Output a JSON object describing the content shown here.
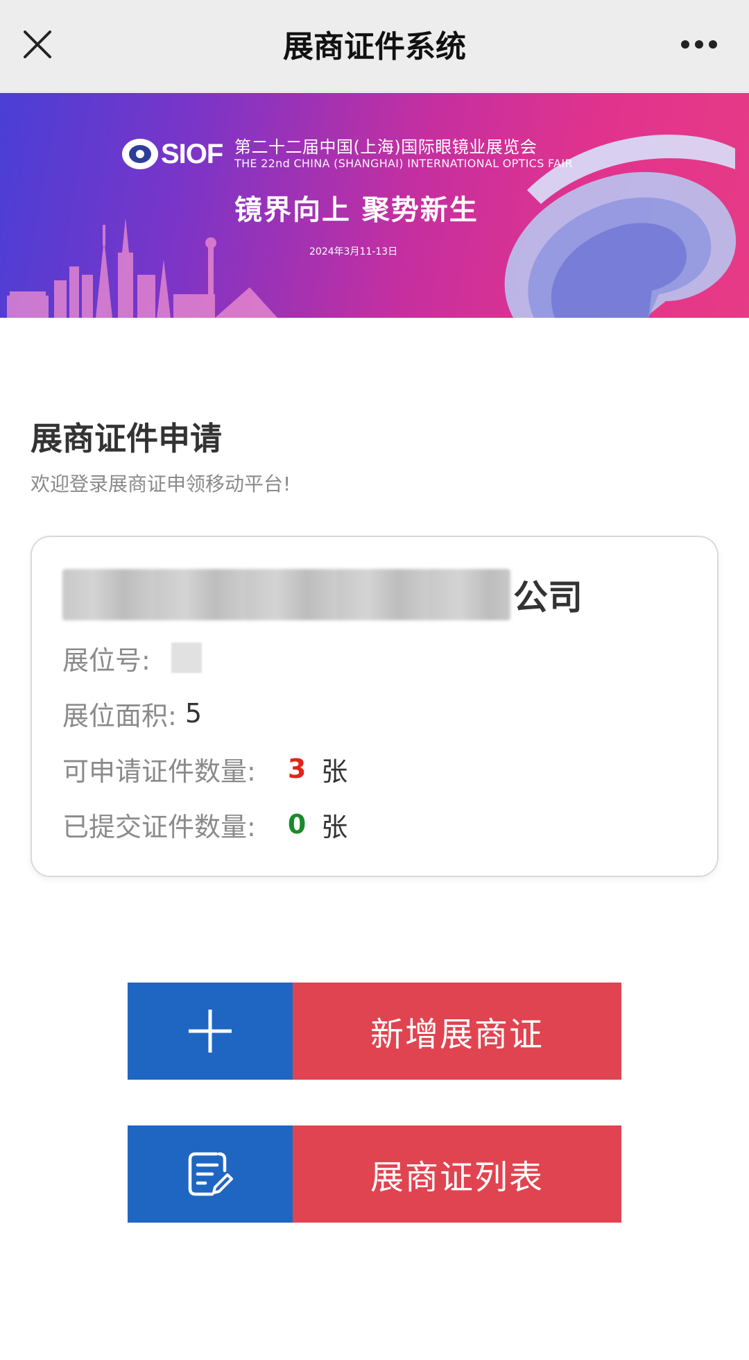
{
  "navbar": {
    "title": "展商证件系统",
    "close_icon": "close-icon",
    "more_icon": "more-icon"
  },
  "banner": {
    "logo_text": "SIOF",
    "fair_name_cn": "第二十二届中国(上海)国际眼镜业展览会",
    "fair_name_en": "THE 22nd CHINA (SHANGHAI) INTERNATIONAL OPTICS FAIR",
    "slogan": "镜界向上 聚势新生",
    "date": "2024年3月11-13日",
    "colors": {
      "start": "#4a3fd6",
      "mid": "#c52fa0",
      "end": "#e63b86"
    }
  },
  "page": {
    "heading": "展商证件申请",
    "subtitle": "欢迎登录展商证申领移动平台!"
  },
  "card": {
    "company_suffix": "公司",
    "booth_label": "展位号:",
    "area_label": "展位面积:",
    "area_value": "5",
    "available_label": "可申请证件数量:",
    "available_count": "3",
    "submitted_label": "已提交证件数量:",
    "submitted_count": "0",
    "unit": "张"
  },
  "actions": {
    "add_label": "新增展商证",
    "list_label": "展商证列表",
    "icon_color": "#1f66c2",
    "label_color": "#e04450"
  }
}
